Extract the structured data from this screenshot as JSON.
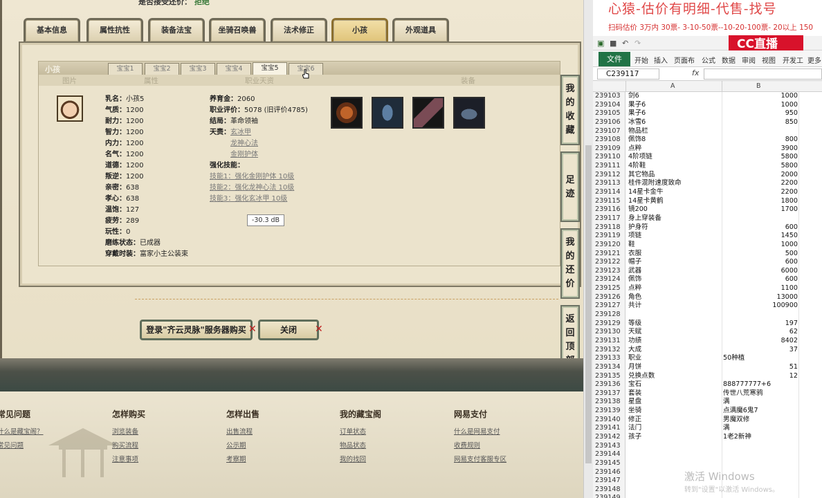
{
  "game": {
    "top_note": "是否接受还价：",
    "top_note_value": "拒绝",
    "tabs": [
      "基本信息",
      "属性抗性",
      "装备法宝",
      "坐骑召唤兽",
      "法术修正",
      "小孩",
      "外观道具"
    ],
    "active_tab": "小孩",
    "panel_title": "小孩",
    "baby_tabs": [
      "宝宝1",
      "宝宝2",
      "宝宝3",
      "宝宝4",
      "宝宝5",
      "宝宝6"
    ],
    "active_baby": "宝宝5",
    "columns": [
      "图片",
      "属性",
      "职业天资",
      "装备"
    ],
    "attributes": [
      {
        "k": "乳名：",
        "v": "小孩5"
      },
      {
        "k": "气质：",
        "v": "1200"
      },
      {
        "k": "耐力：",
        "v": "1200"
      },
      {
        "k": "智力：",
        "v": "1200"
      },
      {
        "k": "内力：",
        "v": "1200"
      },
      {
        "k": "名气：",
        "v": "1200"
      },
      {
        "k": "道德：",
        "v": "1200"
      },
      {
        "k": "叛逆：",
        "v": "1200"
      },
      {
        "k": "亲密：",
        "v": "638"
      },
      {
        "k": "孝心：",
        "v": "638"
      },
      {
        "k": "温饱：",
        "v": "127"
      },
      {
        "k": "疲劳：",
        "v": "289"
      },
      {
        "k": "玩性：",
        "v": "0"
      },
      {
        "k": "磨练状态：",
        "v": "已成器"
      },
      {
        "k": "穿戴时装：",
        "v": "富家小主公装束"
      }
    ],
    "career": {
      "raise_k": "养育金：",
      "raise_v": "2060",
      "eval_k": "职业评价：",
      "eval_v": "5078 (旧评价4785)",
      "ending_k": "结局：",
      "ending_v": "革命领袖",
      "talent_k": "天赉：",
      "talents": [
        "玄冰甲",
        "龙神心法",
        "金刚护体"
      ],
      "skills_title": "强化技能：",
      "skills": [
        "技能1：强化金刚护体 10级",
        "技能2：强化龙神心法 10级",
        "技能3：强化玄冰甲 10级"
      ]
    },
    "tooltip": "-30.3 dB",
    "side_buttons": [
      [
        "我",
        "的",
        "收",
        "藏"
      ],
      [
        "足",
        "迹"
      ],
      [
        "我",
        "的",
        "还",
        "价"
      ],
      [
        "返",
        "回",
        "顶",
        "部"
      ]
    ],
    "buy_button": "登录\"齐云灵脉\"服务器购买",
    "close_button": "关闭",
    "footer_cols": [
      {
        "h": "常见问题",
        "items": [
          "什么是藏宝阁？",
          "常见问题"
        ]
      },
      {
        "h": "怎样购买",
        "items": [
          "浏览装备",
          "购买流程",
          "注意事项"
        ]
      },
      {
        "h": "怎样出售",
        "items": [
          "出售流程",
          "公示期",
          "考察期"
        ]
      },
      {
        "h": "我的藏宝阁",
        "items": [
          "订单状态",
          "物品状态",
          "我的找回"
        ]
      },
      {
        "h": "网易支付",
        "items": [
          "什么是网易支付",
          "收费规则",
          "网易支付客服专区"
        ]
      }
    ]
  },
  "excel": {
    "banner_title": "心猿-估价有明细-代售-找号",
    "banner_sub": "扫码估价 3万内 30票- 3-10-50票--10-20-100票- 20以上 150",
    "logo_text": "CC直播",
    "file_tab": "文件",
    "ribbon_tabs": [
      "开始",
      "插入",
      "页面布",
      "公式",
      "数据",
      "审阅",
      "视图",
      "开发工",
      "更多"
    ],
    "name_box": "C239117",
    "fx": "fx",
    "col_a": "A",
    "col_b": "B",
    "rows": [
      {
        "n": "239103",
        "a": "剑6",
        "b": "1000"
      },
      {
        "n": "239104",
        "a": "果子6",
        "b": "1000"
      },
      {
        "n": "239105",
        "a": "果子6",
        "b": "950"
      },
      {
        "n": "239106",
        "a": "冰雪6",
        "b": "850"
      },
      {
        "n": "239107",
        "a": "物品栏",
        "b": ""
      },
      {
        "n": "239108",
        "a": "佩饰8",
        "b": "800"
      },
      {
        "n": "239109",
        "a": "点粹",
        "b": "3900"
      },
      {
        "n": "239110",
        "a": "4阶项链",
        "b": "5800"
      },
      {
        "n": "239111",
        "a": "4阶鞋",
        "b": "5800"
      },
      {
        "n": "239112",
        "a": "其它物品",
        "b": "2000"
      },
      {
        "n": "239113",
        "a": "桂件混附速度致命",
        "b": "2200"
      },
      {
        "n": "239114",
        "a": "14星卡金牛",
        "b": "2200"
      },
      {
        "n": "239115",
        "a": "14星卡黄鹤",
        "b": "1800"
      },
      {
        "n": "239116",
        "a": "镜200",
        "b": "1700"
      },
      {
        "n": "239117",
        "a": "身上穿装备",
        "b": ""
      },
      {
        "n": "239118",
        "a": "护身符",
        "b": "600"
      },
      {
        "n": "239119",
        "a": "项链",
        "b": "1450"
      },
      {
        "n": "239120",
        "a": "鞋",
        "b": "1000"
      },
      {
        "n": "239121",
        "a": "衣服",
        "b": "500"
      },
      {
        "n": "239122",
        "a": "帽子",
        "b": "600"
      },
      {
        "n": "239123",
        "a": "武器",
        "b": "6000"
      },
      {
        "n": "239124",
        "a": "佩饰",
        "b": "600"
      },
      {
        "n": "239125",
        "a": "点粹",
        "b": "1100"
      },
      {
        "n": "239126",
        "a": "角色",
        "b": "13000"
      },
      {
        "n": "239127",
        "a": "共计",
        "b": "100900"
      },
      {
        "n": "239128",
        "a": "",
        "b": ""
      },
      {
        "n": "239129",
        "a": "等级",
        "b": "197"
      },
      {
        "n": "239130",
        "a": "天赋",
        "b": "62"
      },
      {
        "n": "239131",
        "a": "功绩",
        "b": "8402"
      },
      {
        "n": "239132",
        "a": "大成",
        "b": "37"
      },
      {
        "n": "239133",
        "a": "职业",
        "b": "50种植",
        "t": true
      },
      {
        "n": "239134",
        "a": "月饼",
        "b": "51"
      },
      {
        "n": "239135",
        "a": "兑换点数",
        "b": "12"
      },
      {
        "n": "239136",
        "a": "宝石",
        "b": "888777777+6",
        "t": true
      },
      {
        "n": "239137",
        "a": "套装",
        "b": "传世八荒寒鸦",
        "t": true
      },
      {
        "n": "239138",
        "a": "星盘",
        "b": "满",
        "t": true
      },
      {
        "n": "239139",
        "a": "坐骑",
        "b": "点满魔6鬼7",
        "t": true
      },
      {
        "n": "239140",
        "a": "修正",
        "b": "男魔双修",
        "t": true
      },
      {
        "n": "239141",
        "a": "法门",
        "b": "满",
        "t": true
      },
      {
        "n": "239142",
        "a": "孩子",
        "b": "1老2新神",
        "t": true
      },
      {
        "n": "239143",
        "a": "",
        "b": ""
      },
      {
        "n": "239144",
        "a": "",
        "b": ""
      },
      {
        "n": "239145",
        "a": "",
        "b": ""
      },
      {
        "n": "239146",
        "a": "",
        "b": ""
      },
      {
        "n": "239147",
        "a": "",
        "b": ""
      },
      {
        "n": "239148",
        "a": "",
        "b": ""
      },
      {
        "n": "239149",
        "a": "",
        "b": ""
      }
    ],
    "watermark": "激活 Windows",
    "watermark_sub": "转到\"设置\"以激活 Windows。"
  }
}
